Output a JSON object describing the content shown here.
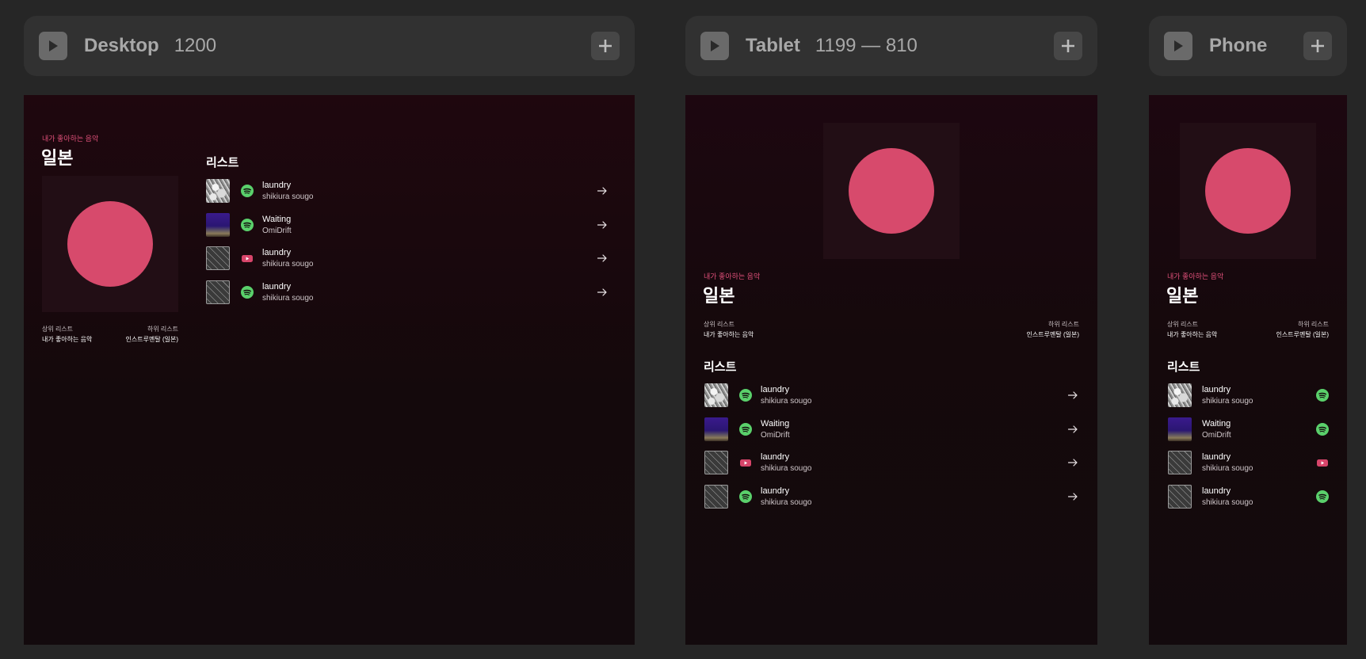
{
  "colors": {
    "accent": "#d74a6c",
    "spotify": "#5ad06b",
    "youtube": "#d7456a",
    "background": "#262626",
    "frame": "#130a0d"
  },
  "icons": {
    "play": "play-icon",
    "add": "plus-icon",
    "spotify": "spotify-icon",
    "youtube": "youtube-icon",
    "arrow": "arrow-right-icon"
  },
  "toolbars": [
    {
      "name": "Desktop",
      "size": "1200"
    },
    {
      "name": "Tablet",
      "size": "1199 — 810"
    },
    {
      "name": "Phone",
      "size": ""
    }
  ],
  "page": {
    "eyebrow": "내가 좋아하는 음악",
    "title": "일본",
    "parent_label": "상위 리스트",
    "parent_value": "내가 좋아하는 음악",
    "child_label": "하위 리스트",
    "child_value": "인스트루멘탈 (일본)",
    "list_title": "리스트"
  },
  "tracks": [
    {
      "title": "laundry",
      "artist": "shikiura sougo",
      "service": "spotify",
      "thumb": "anime"
    },
    {
      "title": "Waiting",
      "artist": "OmiDrift",
      "service": "spotify",
      "thumb": "night"
    },
    {
      "title": "laundry",
      "artist": "shikiura sougo",
      "service": "youtube",
      "thumb": "pattern"
    },
    {
      "title": "laundry",
      "artist": "shikiura sougo",
      "service": "spotify",
      "thumb": "pattern"
    }
  ]
}
